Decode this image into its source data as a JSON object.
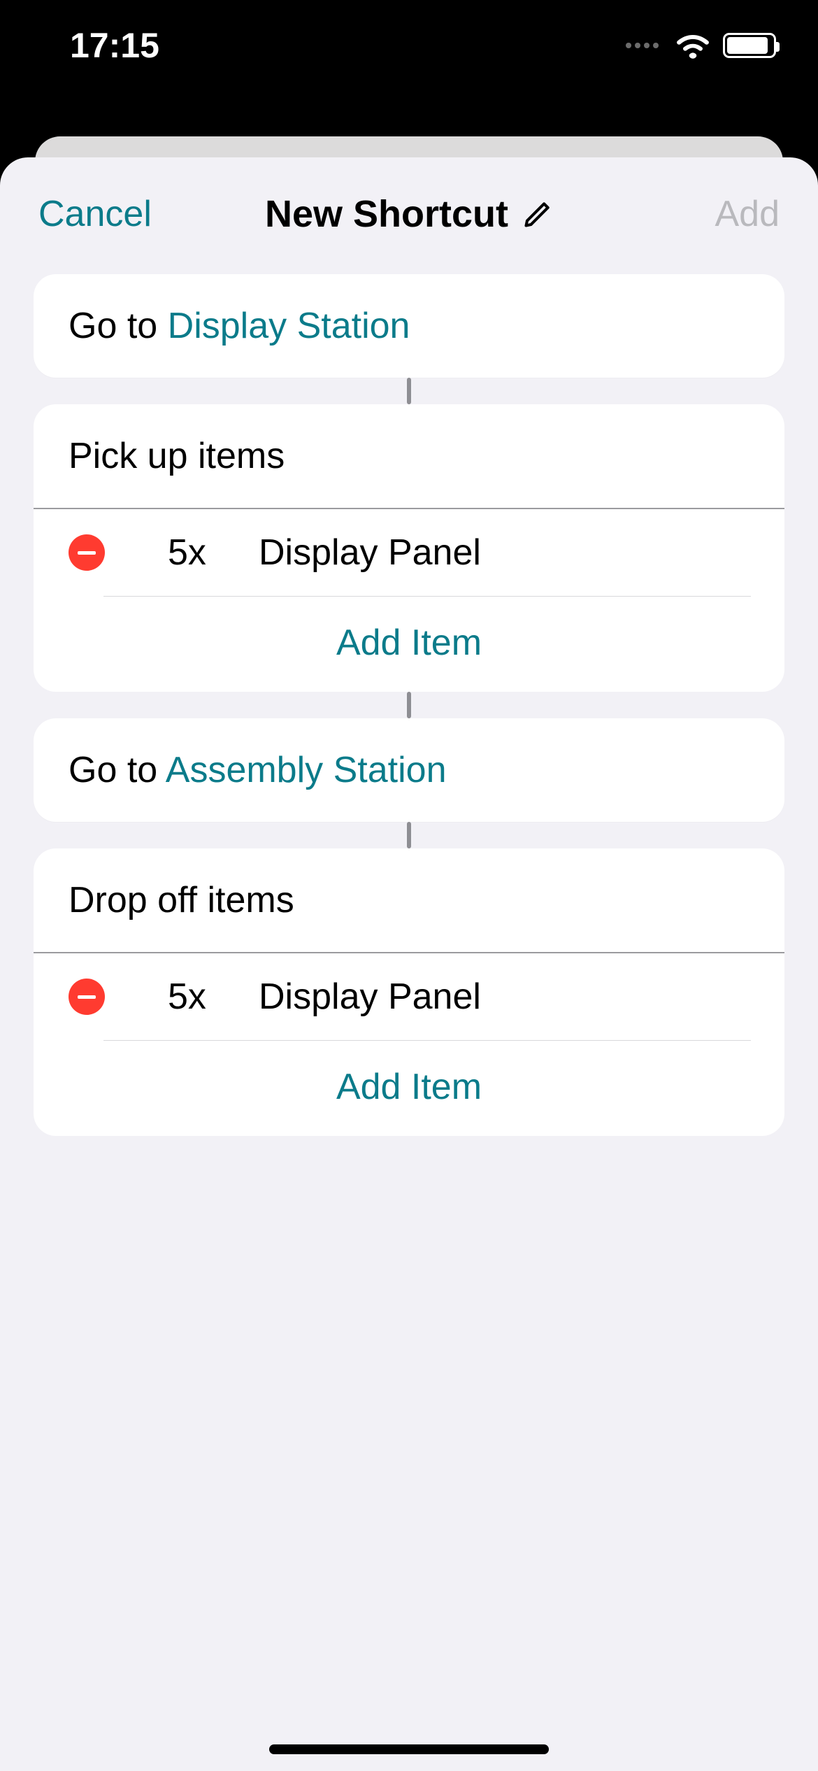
{
  "status": {
    "time": "17:15"
  },
  "header": {
    "cancel": "Cancel",
    "title": "New Shortcut",
    "add": "Add"
  },
  "steps": {
    "go_prefix": "Go to ",
    "step1_destination": "Display Station",
    "pickup_title": "Pick up items",
    "pickup_items": [
      {
        "qty": "5x",
        "name": "Display Panel"
      }
    ],
    "add_item_label": "Add Item",
    "step3_destination": "Assembly Station",
    "dropoff_title": "Drop off items",
    "dropoff_items": [
      {
        "qty": "5x",
        "name": "Display Panel"
      }
    ]
  },
  "colors": {
    "accent": "#0b7b8a",
    "destructive": "#ff3b30",
    "sheet_bg": "#f2f1f6"
  }
}
